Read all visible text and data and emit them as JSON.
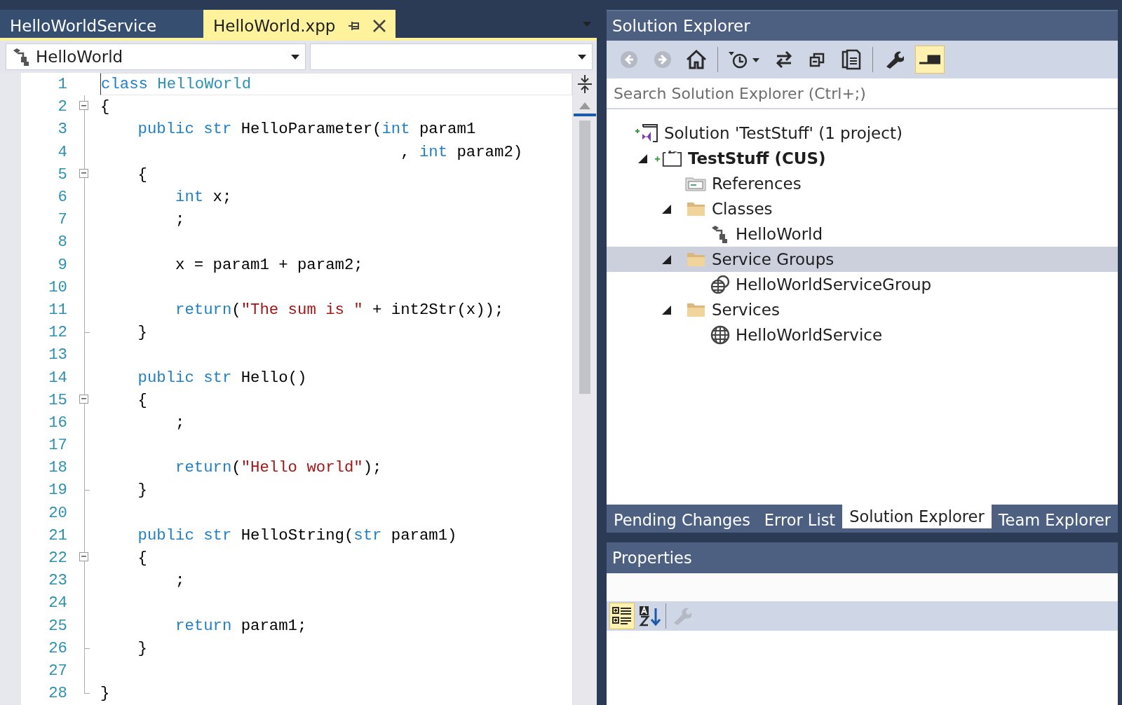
{
  "editor_tabs": [
    {
      "label": "HelloWorldService",
      "selected": false
    },
    {
      "label": "HelloWorld.xpp",
      "selected": true
    }
  ],
  "member_dropdowns": [
    {
      "kind": "class",
      "value": "HelloWorld"
    },
    {
      "kind": "empty"
    }
  ],
  "code_lines": [
    {
      "number": "1",
      "current": true,
      "tokens": [
        {
          "keyword": "class"
        },
        {
          "type": " HelloWorld"
        }
      ]
    },
    {
      "number": "2",
      "fold_start": true,
      "tokens": [
        {
          "text": "{"
        }
      ]
    },
    {
      "number": "3",
      "tokens": [
        {
          "keyword": "    public"
        },
        {
          "keyword": " str"
        },
        {
          "text": " HelloParameter("
        },
        {
          "keyword": "int"
        },
        {
          "text": " param1"
        }
      ]
    },
    {
      "number": "4",
      "tokens": [
        {
          "text": "                                , "
        },
        {
          "keyword": "int"
        },
        {
          "text": " param2)"
        }
      ]
    },
    {
      "number": "5",
      "fold_start": true,
      "tokens": [
        {
          "text": "    {"
        }
      ]
    },
    {
      "number": "6",
      "tokens": [
        {
          "keyword": "        int"
        },
        {
          "text": " x;"
        }
      ]
    },
    {
      "number": "7",
      "tokens": [
        {
          "text": "        ;"
        }
      ]
    },
    {
      "number": "8"
    },
    {
      "number": "9",
      "tokens": [
        {
          "text": "        x = param1 + param2;"
        }
      ]
    },
    {
      "number": "10"
    },
    {
      "number": "11",
      "tokens": [
        {
          "keyword": "        return"
        },
        {
          "text": "("
        },
        {
          "string": "\"The sum is \""
        },
        {
          "text": " + int2Str(x));"
        }
      ]
    },
    {
      "number": "12",
      "fold_end": true,
      "tokens": [
        {
          "text": "    }"
        }
      ]
    },
    {
      "number": "13"
    },
    {
      "number": "14",
      "tokens": [
        {
          "keyword": "    public"
        },
        {
          "keyword": " str"
        },
        {
          "text": " Hello()"
        }
      ]
    },
    {
      "number": "15",
      "fold_start": true,
      "tokens": [
        {
          "text": "    {"
        }
      ]
    },
    {
      "number": "16",
      "tokens": [
        {
          "text": "        ;"
        }
      ]
    },
    {
      "number": "17"
    },
    {
      "number": "18",
      "tokens": [
        {
          "keyword": "        return"
        },
        {
          "text": "("
        },
        {
          "string": "\"Hello world\""
        },
        {
          "text": ");"
        }
      ]
    },
    {
      "number": "19",
      "fold_end": true,
      "tokens": [
        {
          "text": "    }"
        }
      ]
    },
    {
      "number": "20"
    },
    {
      "number": "21",
      "tokens": [
        {
          "keyword": "    public"
        },
        {
          "keyword": " str"
        },
        {
          "text": " HelloString("
        },
        {
          "keyword": "str"
        },
        {
          "text": " param1)"
        }
      ]
    },
    {
      "number": "22",
      "fold_start": true,
      "tokens": [
        {
          "text": "    {"
        }
      ]
    },
    {
      "number": "23",
      "tokens": [
        {
          "text": "        ;"
        }
      ]
    },
    {
      "number": "24"
    },
    {
      "number": "25",
      "tokens": [
        {
          "keyword": "        return"
        },
        {
          "text": " param1;"
        }
      ]
    },
    {
      "number": "26",
      "fold_end": true,
      "tokens": [
        {
          "text": "    }"
        }
      ]
    },
    {
      "number": "27"
    },
    {
      "number": "28",
      "fold_end": true,
      "tokens": [
        {
          "text": "}"
        }
      ]
    }
  ],
  "solution_explorer": {
    "title": "Solution Explorer",
    "toolbar": [
      {
        "kind": "back",
        "disabled": true
      },
      {
        "kind": "forward",
        "disabled": true
      },
      {
        "kind": "home",
        "disabled": false
      },
      {
        "kind": "sep"
      },
      {
        "kind": "history",
        "disabled": false
      },
      {
        "kind": "sync",
        "disabled": false
      },
      {
        "kind": "collapse",
        "disabled": false
      },
      {
        "kind": "pages",
        "disabled": false
      },
      {
        "kind": "sep"
      },
      {
        "kind": "wrench",
        "disabled": false
      },
      {
        "kind": "preview",
        "disabled": false,
        "on": true
      }
    ],
    "search": {
      "placeholder": "Search Solution Explorer (Ctrl+;)"
    },
    "tree": [
      {
        "kind": "solution",
        "label": "Solution 'TestStuff' (1 project)",
        "selected": false,
        "children": [
          {
            "kind": "project",
            "label": "TestStuff (CUS)",
            "bold": true,
            "expanded": true,
            "selected": false,
            "children": [
              {
                "kind": "references",
                "label": "References",
                "selected": false
              },
              {
                "kind": "folder",
                "label": "Classes",
                "expanded": true,
                "selected": false,
                "children": [
                  {
                    "kind": "class",
                    "label": "HelloWorld",
                    "selected": false
                  }
                ]
              },
              {
                "kind": "folder",
                "label": "Service Groups",
                "expanded": true,
                "selected": true,
                "children": [
                  {
                    "kind": "service-group",
                    "label": "HelloWorldServiceGroup",
                    "selected": false
                  }
                ]
              },
              {
                "kind": "folder",
                "label": "Services",
                "expanded": true,
                "selected": false,
                "children": [
                  {
                    "kind": "service",
                    "label": "HelloWorldService",
                    "selected": false
                  }
                ]
              }
            ]
          }
        ]
      }
    ]
  },
  "panel_tabs": [
    {
      "label": "Pending Changes",
      "selected": false
    },
    {
      "label": "Error List",
      "selected": false
    },
    {
      "label": "Solution Explorer",
      "selected": true
    },
    {
      "label": "Team Explorer",
      "selected": false
    }
  ],
  "properties": {
    "title": "Properties",
    "toolbar": [
      {
        "kind": "categorized",
        "on": true,
        "disabled": false
      },
      {
        "kind": "alphabetical",
        "on": false,
        "disabled": false
      },
      {
        "kind": "sep"
      },
      {
        "kind": "wrench",
        "on": false,
        "disabled": true
      }
    ]
  }
}
